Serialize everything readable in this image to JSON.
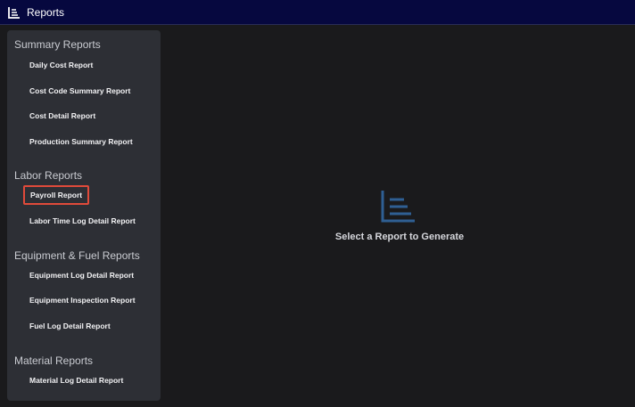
{
  "header": {
    "title": "Reports",
    "icon": "reports-icon"
  },
  "sidebar": {
    "sections": [
      {
        "title": "Summary Reports",
        "items": [
          "Daily Cost Report",
          "Cost Code Summary Report",
          "Cost Detail Report",
          "Production Summary Report"
        ]
      },
      {
        "title": "Labor Reports",
        "items": [
          "Payroll Report",
          "Labor Time Log Detail Report"
        ]
      },
      {
        "title": "Equipment & Fuel Reports",
        "items": [
          "Equipment Log Detail Report",
          "Equipment Inspection Report",
          "Fuel Log Detail Report"
        ]
      },
      {
        "title": "Material Reports",
        "items": [
          "Material Log Detail Report"
        ]
      }
    ],
    "highlighted_item": "Payroll Report"
  },
  "main": {
    "empty_state_text": "Select a Report to Generate",
    "empty_state_icon": "reports-icon"
  },
  "colors": {
    "titlebar": "#06083f",
    "background": "#1a1a1c",
    "sidebar": "#2d2f35",
    "highlight_border": "#e04a3a",
    "icon_accent": "#2f5f93"
  }
}
